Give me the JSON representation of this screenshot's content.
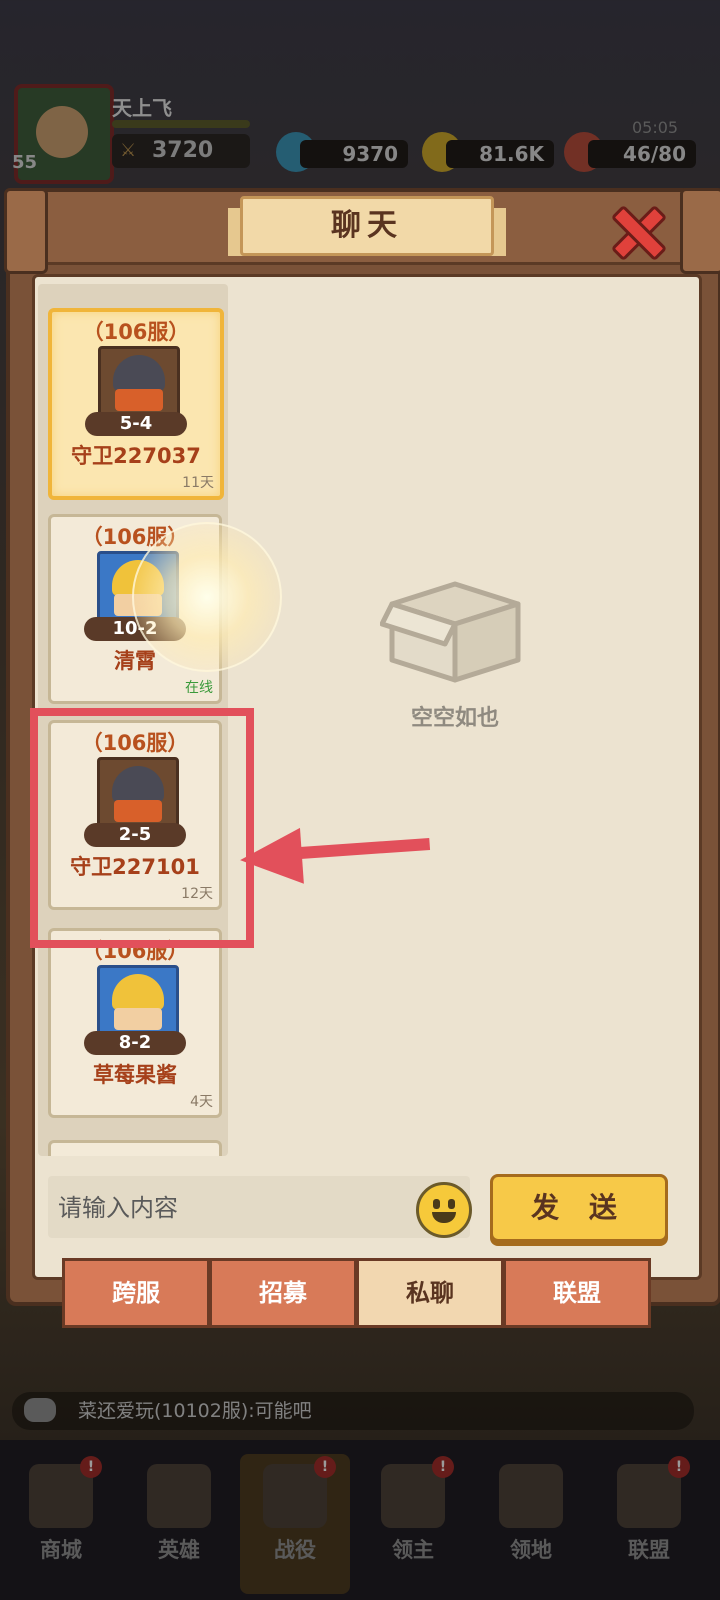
{
  "hud": {
    "player_name": "天上飞",
    "level": "55",
    "power": "3720",
    "gems": "9370",
    "gold": "81.6K",
    "stamina": "46/80",
    "time": "05:05"
  },
  "panel": {
    "title": "聊天",
    "empty_text": "空空如也"
  },
  "contacts": [
    {
      "server": "（106服）",
      "stage": "5-4",
      "name": "守卫227037",
      "status": "11天",
      "online": false
    },
    {
      "server": "（106服）",
      "stage": "10-2",
      "name": "清霄",
      "status": "在线",
      "online": true
    },
    {
      "server": "（106服）",
      "stage": "2-5",
      "name": "守卫227101",
      "status": "12天",
      "online": false
    },
    {
      "server": "（106服）",
      "stage": "8-2",
      "name": "草莓果酱",
      "status": "4天",
      "online": false
    }
  ],
  "input": {
    "placeholder": "请输入内容",
    "send_label": "发 送"
  },
  "tabs": [
    "跨服",
    "招募",
    "私聊",
    "联盟"
  ],
  "ticker": "菜还爱玩(10102服):可能吧",
  "nav": [
    "商城",
    "英雄",
    "战役",
    "领主",
    "领地",
    "联盟"
  ],
  "colors": {
    "accent_orange": "#b8511e",
    "highlight_red": "#e2505b",
    "send_yellow": "#f7c948",
    "online_green": "#3a9a3a"
  }
}
